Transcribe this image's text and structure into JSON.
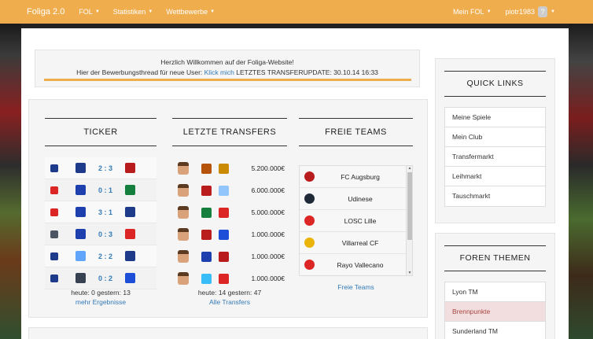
{
  "navbar": {
    "brand": "Foliga 2.0",
    "menu": [
      {
        "label": "FOL"
      },
      {
        "label": "Statistiken"
      },
      {
        "label": "Wettbewerbe"
      }
    ],
    "right": {
      "my_fol": "Mein FOL",
      "user": "piotr1983",
      "help": "?"
    },
    "colors": {
      "bar": "#f0ad4e",
      "text": "#ffffff"
    }
  },
  "welcome": {
    "line1": "Herzlich Willkommen auf der Foliga-Website!",
    "line2_pre": "Hier der Bewerbungsthread für neue User:",
    "line2_link": "Klick mich",
    "line2_post": "LETZTES TRANSFERUPDATE: 30.10.14 16:33"
  },
  "ticker": {
    "title": "TICKER",
    "matches": [
      {
        "home_crest": "#1e3a8a",
        "score": "2 : 3",
        "away_crest": "#b91c1c"
      },
      {
        "home_crest": "#1e40af",
        "score": "0 : 1",
        "away_crest": "#15803d"
      },
      {
        "home_crest": "#1e40af",
        "score": "3 : 1",
        "away_crest": "#1e3a8a"
      },
      {
        "home_crest": "#1e40af",
        "score": "0 : 3",
        "away_crest": "#dc2626"
      },
      {
        "home_crest": "#60a5fa",
        "score": "2 : 2",
        "away_crest": "#1e3a8a"
      },
      {
        "home_crest": "#374151",
        "score": "0 : 2",
        "away_crest": "#1d4ed8"
      }
    ],
    "league_badges": [
      "#1e3a8a",
      "#dc2626",
      "#dc2626",
      "#4b5563",
      "#1e3a8a",
      "#1e3a8a"
    ],
    "summary": "heute: 0   gestern: 13",
    "more_link": "mehr Ergebnisse"
  },
  "transfers": {
    "title": "LETZTE TRANSFERS",
    "rows": [
      {
        "from_crest": "#b45309",
        "to_crest": "#ca8a04",
        "fee": "5.200.000€"
      },
      {
        "from_crest": "#b91c1c",
        "to_crest": "#93c5fd",
        "fee": "6.000.000€"
      },
      {
        "from_crest": "#15803d",
        "to_crest": "#dc2626",
        "fee": "5.000.000€"
      },
      {
        "from_crest": "#b91c1c",
        "to_crest": "#1d4ed8",
        "fee": "1.000.000€"
      },
      {
        "from_crest": "#1e40af",
        "to_crest": "#b91c1c",
        "fee": "1.000.000€"
      },
      {
        "from_crest": "#38bdf8",
        "to_crest": "#dc2626",
        "fee": "1.000.000€"
      }
    ],
    "summary": "heute: 14   gestern: 47",
    "more_link": "Alle Transfers"
  },
  "free_teams": {
    "title": "FREIE TEAMS",
    "teams": [
      {
        "name": "FC Augsburg",
        "crest": "#b91c1c"
      },
      {
        "name": "Udinese",
        "crest": "#1f2937"
      },
      {
        "name": "LOSC Lille",
        "crest": "#dc2626"
      },
      {
        "name": "Villarreal CF",
        "crest": "#eab308"
      },
      {
        "name": "Rayo Vallecano",
        "crest": "#dc2626"
      }
    ],
    "more_link": "Freie Teams"
  },
  "quick_links": {
    "title": "QUICK LINKS",
    "items": [
      "Meine Spiele",
      "Mein Club",
      "Transfermarkt",
      "Leihmarkt",
      "Tauschmarkt"
    ]
  },
  "forum": {
    "title": "FOREN THEMEN",
    "items": [
      "Lyon TM",
      "Brennpunkte",
      "Sunderland TM"
    ],
    "active_index": 1
  }
}
